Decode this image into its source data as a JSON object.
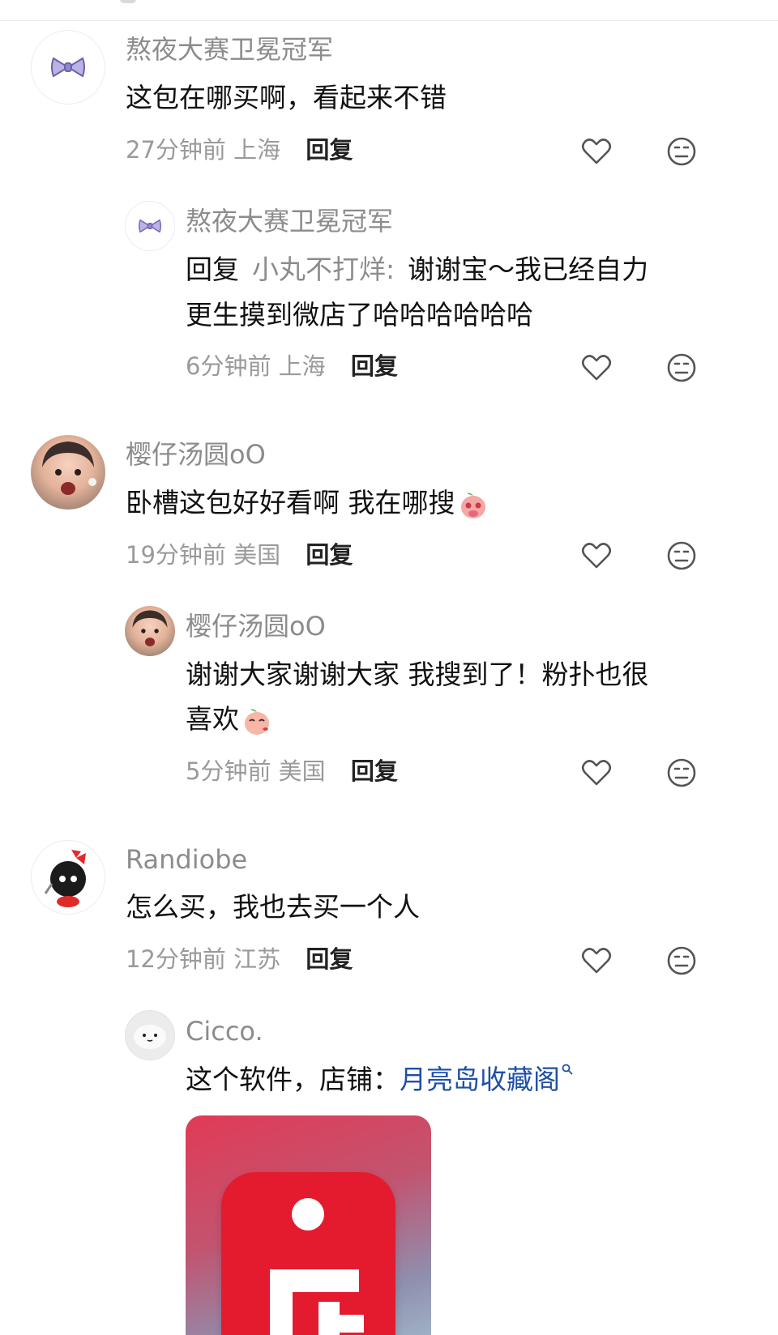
{
  "comments": [
    {
      "username": "熬夜大赛卫冕冠军",
      "text": "这包在哪买啊，看起来不错",
      "time": "27分钟前",
      "location": "上海",
      "reply_label": "回复",
      "replies": [
        {
          "username": "熬夜大赛卫冕冠军",
          "reply_prefix": "回复",
          "reply_to": "小丸不打烊:",
          "text_line1": "谢谢宝～我已经自力",
          "text_line2": "更生摸到微店了哈哈哈哈哈哈",
          "time": "6分钟前",
          "location": "上海",
          "reply_label": "回复"
        }
      ]
    },
    {
      "username": "樱仔汤圆oO",
      "text": "卧槽这包好好看啊 我在哪搜",
      "time": "19分钟前",
      "location": "美国",
      "reply_label": "回复",
      "replies": [
        {
          "username": "樱仔汤圆oO",
          "text_line1": "谢谢大家谢谢大家 我搜到了！粉扑也很",
          "text_line2": "喜欢",
          "time": "5分钟前",
          "location": "美国",
          "reply_label": "回复"
        }
      ]
    },
    {
      "username": "Randiobe",
      "text": "怎么买，我也去买一个人",
      "time": "12分钟前",
      "location": "江苏",
      "reply_label": "回复",
      "replies": [
        {
          "username": "Cicco.",
          "text_prefix": "这个软件，店铺：",
          "link_text": "月亮岛收藏阁"
        }
      ]
    }
  ],
  "icons": {
    "like": "heart-outline-icon",
    "dislike": "neutral-face-icon",
    "search": "search-icon",
    "shop": "weidian-shop-app-icon"
  },
  "colors": {
    "username": "#8c8c8c",
    "link": "#1e4fa8",
    "shop_icon_red": "#e41b2e"
  }
}
